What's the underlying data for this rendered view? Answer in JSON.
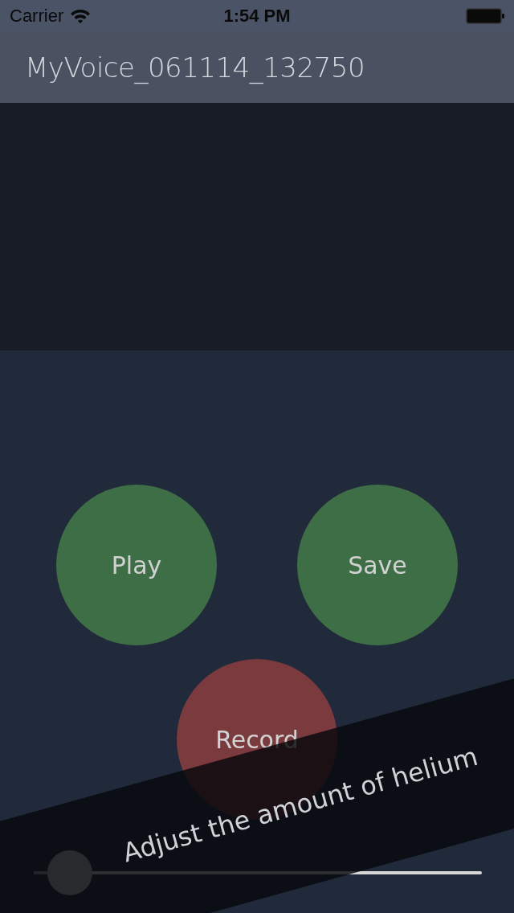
{
  "status_bar": {
    "carrier": "Carrier",
    "time": "1:54 PM"
  },
  "title": "MyVoice_061114_132750",
  "buttons": [
    {
      "label": "Play",
      "color": "#3d6e45"
    },
    {
      "label": "Save",
      "color": "#3d6e45"
    },
    {
      "label": "Record",
      "color": "#7a3a3e"
    }
  ],
  "slider": {
    "level": 0.08
  },
  "coach_mark": {
    "text": "Adjust the amount of helium"
  }
}
